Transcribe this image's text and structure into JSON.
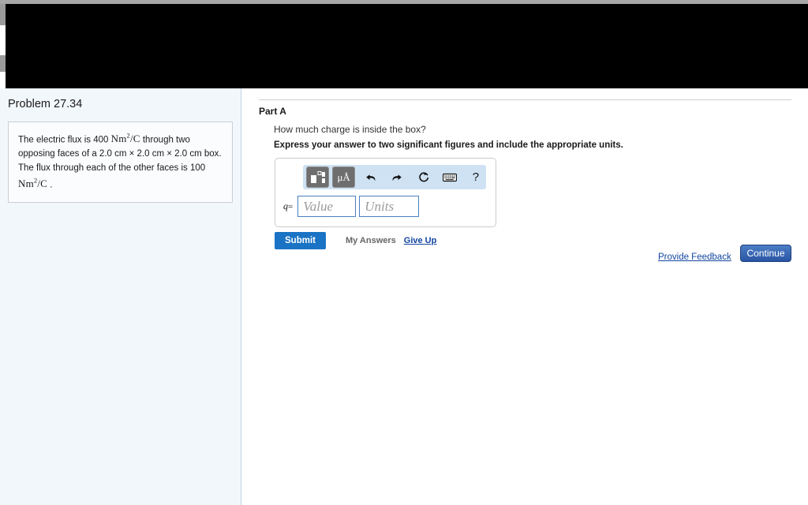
{
  "problem": {
    "title": "Problem 27.34",
    "statement_parts": {
      "p1": "The electric flux is 400 ",
      "unit1": "Nm",
      "sup1": "2",
      "unit1_tail": "/C",
      "p2": " through two opposing faces of a 2.0 cm × 2.0 cm × 2.0 cm box. The flux through each of the other faces is 100 ",
      "unit2": "Nm",
      "sup2": "2",
      "unit2_tail": "/C",
      "p3": " ."
    }
  },
  "part": {
    "heading": "Part A",
    "question": "How much charge is inside the box?",
    "instruction": "Express your answer to two significant figures and include the appropriate units."
  },
  "answer": {
    "variable_label": "q",
    "equals_sign": "=",
    "value_placeholder": "Value",
    "value_text": "",
    "units_placeholder": "Units",
    "units_text": "",
    "toolbar": {
      "template_icon": "math-template-icon",
      "units_icon_label": "μÅ",
      "undo_icon": "undo-icon",
      "redo_icon": "redo-icon",
      "reset_icon": "reset-icon",
      "keyboard_icon": "keyboard-icon",
      "help_label": "?"
    }
  },
  "actions": {
    "submit_label": "Submit",
    "my_answers_label": "My Answers",
    "give_up_label": "Give Up",
    "provide_feedback_label": "Provide Feedback",
    "continue_label": "Continue"
  },
  "colors": {
    "submit_blue": "#1a73c4",
    "link_blue": "#1246a0",
    "toolbar_blue": "#cfe2f3",
    "panel_bg": "#f2f7fc",
    "input_border": "#4a7fc1"
  }
}
